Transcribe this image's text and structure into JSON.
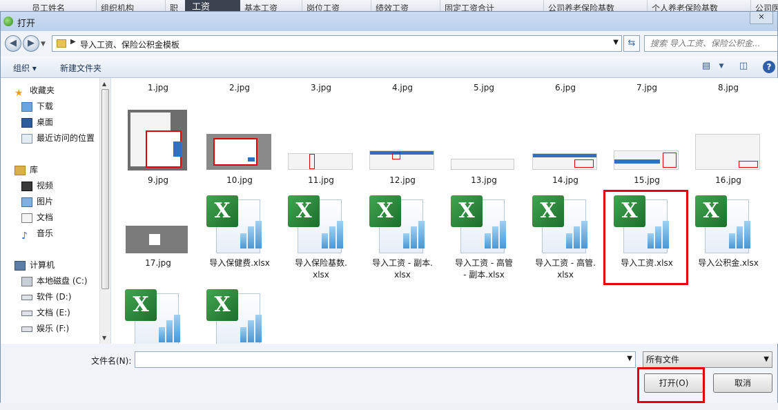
{
  "background_sheet": {
    "columns": [
      "员工姓名",
      "组织机构",
      "职",
      "基本工资",
      "岗位工资",
      "绩效工资",
      "固定工资合计",
      "公司养老保险基数",
      "个人养老保险基数",
      "公司医"
    ],
    "active_tab": "工资"
  },
  "dialog": {
    "title": "打开",
    "close_label": "✕",
    "address": {
      "path": "导入工资、保险公积金模板"
    },
    "search": {
      "placeholder": "搜索 导入工资、保险公积金..."
    },
    "toolbar": {
      "organize_label": "组织 ▾",
      "new_folder_label": "新建文件夹"
    },
    "nav": {
      "favorites_label": "收藏夹",
      "favorites": [
        "下载",
        "桌面",
        "最近访问的位置"
      ],
      "libraries_label": "库",
      "libraries": [
        "视频",
        "图片",
        "文档",
        "音乐"
      ],
      "computer_label": "计算机",
      "drives": [
        "本地磁盘 (C:)",
        "软件 (D:)",
        "文档 (E:)",
        "娱乐 (F:)"
      ]
    },
    "files": [
      {
        "name": "1.jpg"
      },
      {
        "name": "2.jpg"
      },
      {
        "name": "3.jpg"
      },
      {
        "name": "4.jpg"
      },
      {
        "name": "5.jpg"
      },
      {
        "name": "6.jpg"
      },
      {
        "name": "7.jpg"
      },
      {
        "name": "8.jpg"
      },
      {
        "name": "9.jpg"
      },
      {
        "name": "10.jpg"
      },
      {
        "name": "11.jpg"
      },
      {
        "name": "12.jpg"
      },
      {
        "name": "13.jpg"
      },
      {
        "name": "14.jpg"
      },
      {
        "name": "15.jpg"
      },
      {
        "name": "16.jpg"
      },
      {
        "name": "17.jpg"
      },
      {
        "name": "导入保健费.xlsx"
      },
      {
        "name": "导入保险基数.xlsx",
        "line1": "导入保险基数.",
        "line2": "xlsx"
      },
      {
        "name": "导入工资 - 副本.xlsx",
        "line1": "导入工资 - 副本.",
        "line2": "xlsx"
      },
      {
        "name": "导入工资 - 高管 - 副本.xlsx",
        "line1": "导入工资 - 高管",
        "line2": "- 副本.xlsx"
      },
      {
        "name": "导入工资 - 高管.xlsx",
        "line1": "导入工资 - 高管.",
        "line2": "xlsx"
      },
      {
        "name": "导入工资.xlsx",
        "selected": true
      },
      {
        "name": "导入公积金.xlsx"
      }
    ],
    "footer": {
      "filename_label": "文件名(N):",
      "filename_value": "",
      "filetype_label": "所有文件",
      "open_label": "打开(O)",
      "cancel_label": "取消"
    },
    "colors": {
      "highlight": "#e0000a",
      "excel_green": "#1d6e2b"
    },
    "icons": [
      "back-icon",
      "forward-icon",
      "folder-icon",
      "refresh-icon",
      "view-icon",
      "preview-pane-icon",
      "help-icon",
      "star-icon",
      "library-icon",
      "computer-icon",
      "drive-icon",
      "excel-file-icon"
    ]
  }
}
